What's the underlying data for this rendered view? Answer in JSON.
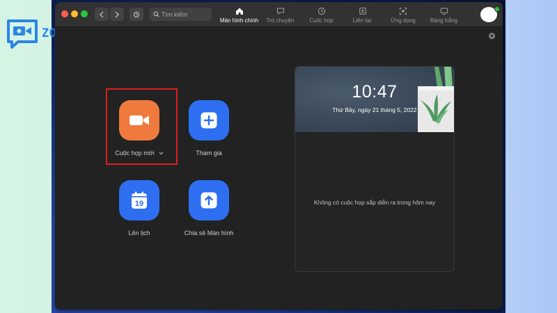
{
  "brand": {
    "name": "ZOOMMEETING"
  },
  "window": {
    "search": {
      "placeholder": "Tìm kiếm"
    },
    "tabs": [
      {
        "label": "Màn hình chính",
        "icon": "home-icon",
        "active": true
      },
      {
        "label": "Trò chuyện",
        "icon": "chat-icon",
        "active": false
      },
      {
        "label": "Cuộc họp",
        "icon": "clock-icon",
        "active": false
      },
      {
        "label": "Liên lạc",
        "icon": "contact-icon",
        "active": false
      },
      {
        "label": "Ứng dụng",
        "icon": "apps-icon",
        "active": false
      },
      {
        "label": "Bảng trắng",
        "icon": "whiteboard-icon",
        "active": false
      }
    ]
  },
  "actions": {
    "new_meeting": {
      "label": "Cuộc họp mới",
      "icon": "video-camera-icon",
      "color": "#f07a3d"
    },
    "join": {
      "label": "Tham gia",
      "icon": "plus-icon",
      "color": "#2d6ff0"
    },
    "schedule": {
      "label": "Lên lịch",
      "icon": "calendar-icon",
      "calendar_day": "19",
      "color": "#2d6ff0"
    },
    "share": {
      "label": "Chia sẻ Màn hình",
      "icon": "share-arrow-icon",
      "color": "#2d6ff0"
    }
  },
  "panel": {
    "time": "10:47",
    "date": "Thứ Bảy, ngày 21 tháng 5, 2022",
    "empty_message": "Không có cuộc họp sắp diễn ra trong hôm nay"
  },
  "colors": {
    "highlight_border": "#e01e1e",
    "status_online": "#26c740"
  }
}
